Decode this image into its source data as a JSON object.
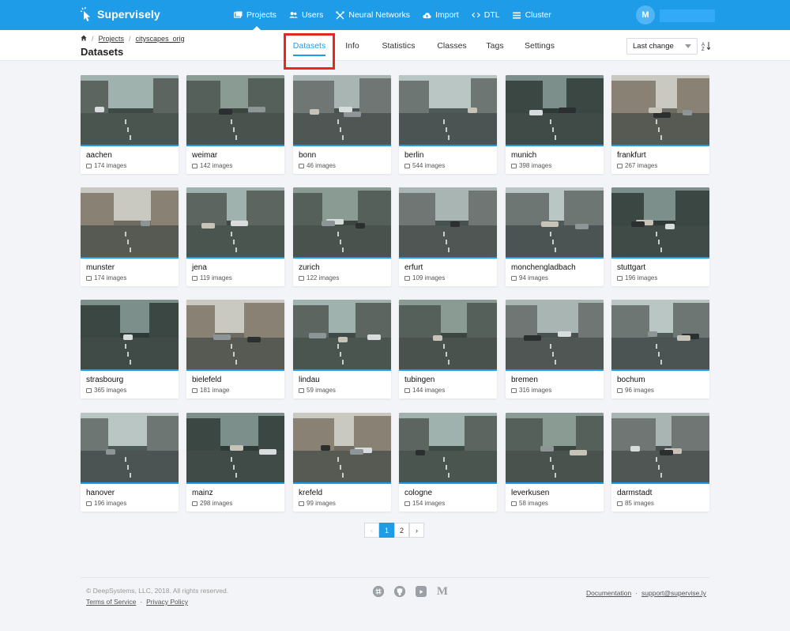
{
  "app": {
    "brand": "Supervisely",
    "avatar_initial": "M"
  },
  "nav": [
    {
      "label": "Projects",
      "icon": "projects-icon",
      "active": true
    },
    {
      "label": "Users",
      "icon": "users-icon"
    },
    {
      "label": "Neural Networks",
      "icon": "neural-networks-icon"
    },
    {
      "label": "Import",
      "icon": "cloud-upload-icon"
    },
    {
      "label": "DTL",
      "icon": "code-icon"
    },
    {
      "label": "Cluster",
      "icon": "list-icon"
    }
  ],
  "breadcrumb": {
    "home_icon": "home-icon",
    "projects": "Projects",
    "project": "cityscapes_orig"
  },
  "page_title": "Datasets",
  "tabs": [
    "Datasets",
    "Info",
    "Statistics",
    "Classes",
    "Tags",
    "Settings"
  ],
  "active_tab": "Datasets",
  "sort": {
    "selected": "Last change"
  },
  "datasets": [
    {
      "name": "aachen",
      "count": "174 images"
    },
    {
      "name": "weimar",
      "count": "142 images"
    },
    {
      "name": "bonn",
      "count": "46 images"
    },
    {
      "name": "berlin",
      "count": "544 images"
    },
    {
      "name": "munich",
      "count": "398 images"
    },
    {
      "name": "frankfurt",
      "count": "267 images"
    },
    {
      "name": "munster",
      "count": "174 images"
    },
    {
      "name": "jena",
      "count": "119 images"
    },
    {
      "name": "zurich",
      "count": "122 images"
    },
    {
      "name": "erfurt",
      "count": "109 images"
    },
    {
      "name": "monchengladbach",
      "count": "94 images"
    },
    {
      "name": "stuttgart",
      "count": "196 images"
    },
    {
      "name": "strasbourg",
      "count": "365 images"
    },
    {
      "name": "bielefeld",
      "count": "181 image"
    },
    {
      "name": "lindau",
      "count": "59 images"
    },
    {
      "name": "tubingen",
      "count": "144 images"
    },
    {
      "name": "bremen",
      "count": "316 images"
    },
    {
      "name": "bochum",
      "count": "96 images"
    },
    {
      "name": "hanover",
      "count": "196 images"
    },
    {
      "name": "mainz",
      "count": "298 images"
    },
    {
      "name": "krefeld",
      "count": "99 images"
    },
    {
      "name": "cologne",
      "count": "154 images"
    },
    {
      "name": "leverkusen",
      "count": "58 images"
    },
    {
      "name": "darmstadt",
      "count": "85 images"
    }
  ],
  "pagination": {
    "prev": "‹",
    "pages": [
      "1",
      "2"
    ],
    "current": "1",
    "next": "›"
  },
  "footer": {
    "copyright": "© DeepSystems, LLC, 2018. All rights reserved.",
    "terms": "Terms of Service",
    "privacy": "Privacy Policy",
    "documentation": "Documentation",
    "support": "support@supervise.ly",
    "separator": "·",
    "social": [
      "slack-icon",
      "github-icon",
      "youtube-icon",
      "medium-icon"
    ]
  },
  "colors": {
    "brand": "#1e9ce8",
    "highlight": "#e8281e"
  }
}
